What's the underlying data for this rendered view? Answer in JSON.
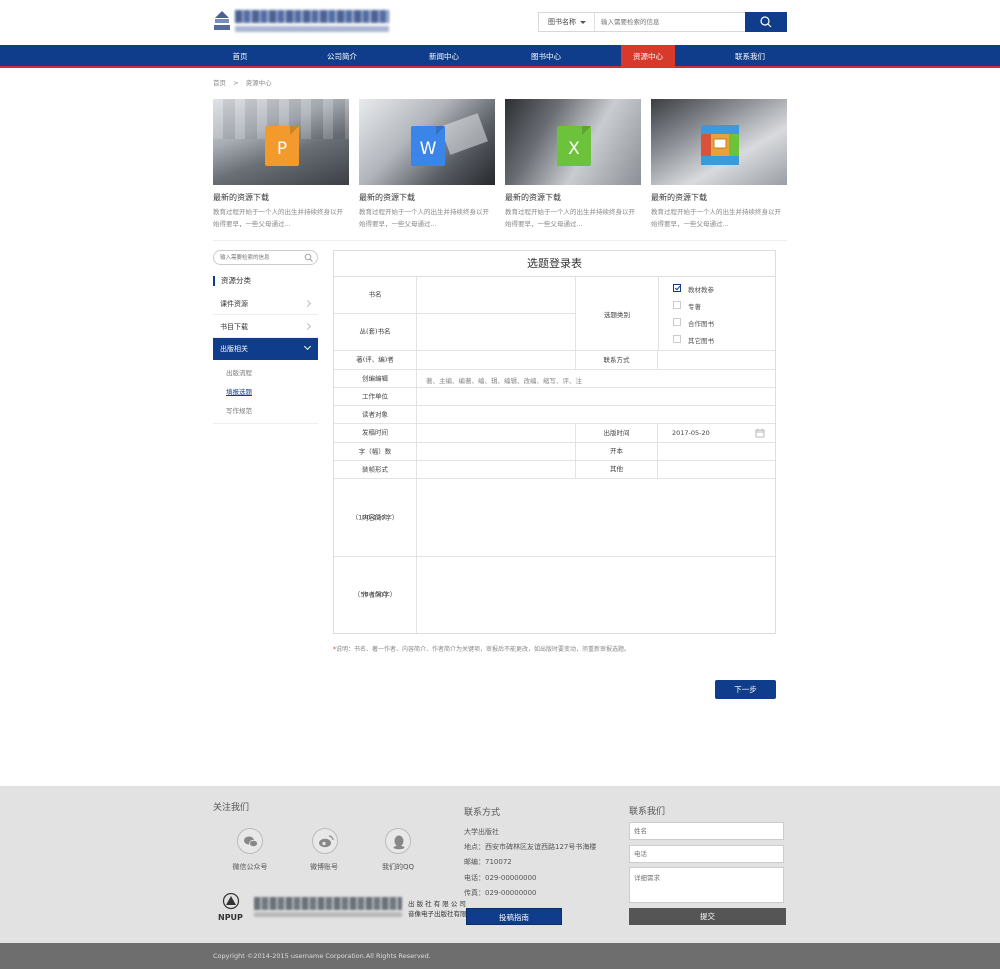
{
  "header": {
    "search_category": "图书名称",
    "search_placeholder": "输入需要检索的信息"
  },
  "nav": {
    "items": [
      "首页",
      "公司简介",
      "新闻中心",
      "图书中心",
      "资源中心",
      "联系我们"
    ],
    "active": "资源中心"
  },
  "breadcrumb": [
    "首页",
    ">",
    "资源中心"
  ],
  "resources": [
    {
      "icon": "ppt-file-icon",
      "letter": "P",
      "color": "#f39a2c",
      "title": "最新的资源下载",
      "desc": "教育过程开始于一个人的出生并持续终身以开始得要早，一些父母通过..."
    },
    {
      "icon": "word-file-icon",
      "letter": "W",
      "color": "#3b85e8",
      "title": "最新的资源下载",
      "desc": "教育过程开始于一个人的出生并持续终身以开始得要早，一些父母通过..."
    },
    {
      "icon": "excel-file-icon",
      "letter": "X",
      "color": "#6cc23a",
      "title": "最新的资源下载",
      "desc": "教育过程开始于一个人的出生并持续终身以开始得要早，一些父母通过..."
    },
    {
      "icon": "archive-file-icon",
      "letter": "",
      "color": "#e8a23a",
      "title": "最新的资源下载",
      "desc": "教育过程开始于一个人的出生并持续终身以开始得要早，一些父母通过..."
    }
  ],
  "sidebar": {
    "search_placeholder": "输入需要检索的信息",
    "title": "资源分类",
    "items": [
      "课件资源",
      "书目下载",
      "出版相关"
    ],
    "active_item": "出版相关",
    "sub_items": [
      "出版流程",
      "填报选题",
      "写作规范"
    ],
    "active_sub": "填报选题"
  },
  "form": {
    "title": "选题登录表",
    "labels": {
      "book_name": "书名",
      "series_name": "丛(套)书名",
      "topic_category": "选题类别",
      "author": "著(评、编)者",
      "contact": "联系方式",
      "author_role": "创编编辑",
      "work_unit": "工作单位",
      "readers": "读者对象",
      "submit_time": "发稿时间",
      "publish_time": "出版时间",
      "word_count": "字（幅）数",
      "format": "开本",
      "binding": "装帧形式",
      "other": "其他",
      "content_intro": "内容简介",
      "content_intro_limit": "（100-120字）",
      "author_intro": "作者简介",
      "author_intro_limit": "（50-100字）"
    },
    "categories": [
      {
        "label": "教材教参",
        "checked": true
      },
      {
        "label": "专著",
        "checked": false
      },
      {
        "label": "合作图书",
        "checked": false
      },
      {
        "label": "其它图书",
        "checked": false
      }
    ],
    "author_role_options": "著、主编、编著、编、辑、编辑、改编、缩写、评、注",
    "publish_date": "2017-05-20"
  },
  "note": {
    "star": "*",
    "text": "说明：书名、著一作者、内容简介、作者简介为关键项，审报后不能更改，如出版时要变动，须重新审报选题。"
  },
  "next_button": "下一步",
  "footer": {
    "follow_title": "关注我们",
    "socials": [
      {
        "icon": "wechat-icon",
        "label": "微信公众号"
      },
      {
        "icon": "weibo-icon",
        "label": "微博账号"
      },
      {
        "icon": "qq-icon",
        "label": "我们的QQ"
      }
    ],
    "contact_title": "联系方式",
    "contact_lines": [
      "大学出版社",
      "地点：西安市碑林区友谊西路127号书海楼",
      "邮编：710072",
      "电话：029-00000000",
      "传真：029-00000000"
    ],
    "guide_button": "投稿指南",
    "contact_us_title": "联系我们",
    "form_placeholders": {
      "name": "姓名",
      "phone": "电话",
      "detail": "详细需求"
    },
    "submit_button": "提交",
    "brand": "NPUP",
    "brand_line1": "出 版 社 有 限 公 司",
    "brand_line2": "音像电子出版社有限公司"
  },
  "copyright": "Copyright ©2014-2015 username Corporation.All Rights Reserved.",
  "colors": {
    "primary": "#0f3d8c",
    "accent": "#d73a2b",
    "footer_bg": "#e2e2e2",
    "copyright_bg": "#6e6e6e"
  }
}
